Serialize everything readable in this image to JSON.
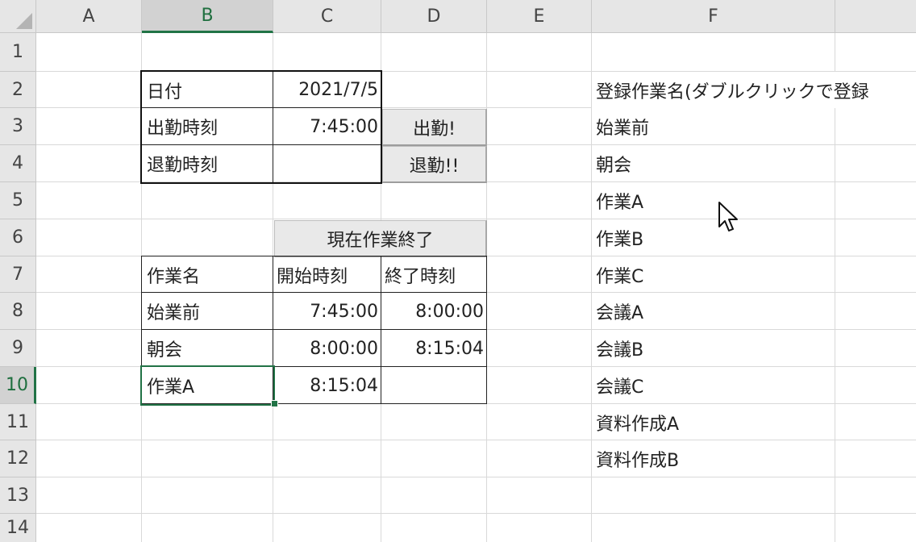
{
  "columns": [
    "A",
    "B",
    "C",
    "D",
    "E",
    "F"
  ],
  "selected_column": "B",
  "rows": [
    "1",
    "2",
    "3",
    "4",
    "5",
    "6",
    "7",
    "8",
    "9",
    "10",
    "11",
    "12",
    "13",
    "14"
  ],
  "selected_row": "10",
  "attendance": {
    "date_label": "日付",
    "date_value": "2021/7/5",
    "start_label": "出勤時刻",
    "start_value": "7:45:00",
    "end_label": "退勤時刻",
    "end_value": ""
  },
  "buttons": {
    "clock_in": "出勤!",
    "clock_out": "退勤!!",
    "end_current_task": "現在作業終了"
  },
  "task_log": {
    "headers": [
      "作業名",
      "開始時刻",
      "終了時刻"
    ],
    "rows": [
      {
        "name": "始業前",
        "start": "7:45:00",
        "end": "8:00:00"
      },
      {
        "name": "朝会",
        "start": "8:00:00",
        "end": "8:15:04"
      },
      {
        "name": "作業A",
        "start": "8:15:04",
        "end": ""
      }
    ]
  },
  "registered_tasks": {
    "header": "登録作業名(ダブルクリックで登録",
    "items": [
      "始業前",
      "朝会",
      "作業A",
      "作業B",
      "作業C",
      "会議A",
      "会議B",
      "会議C",
      "資料作成A",
      "資料作成B"
    ]
  },
  "colors": {
    "accent": "#217346",
    "header_bg": "#e6e6e6",
    "gridline": "#d9d9d9"
  }
}
